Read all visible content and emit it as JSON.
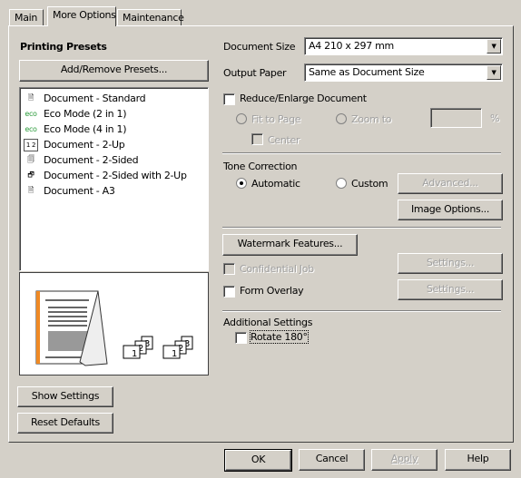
{
  "tabs": [
    {
      "label": "Main"
    },
    {
      "label": "More Options",
      "active": true
    },
    {
      "label": "Maintenance"
    }
  ],
  "presets": {
    "title": "Printing Presets",
    "add_remove_label": "Add/Remove Presets...",
    "items": [
      {
        "label": "Document - Standard",
        "icon": "document-icon"
      },
      {
        "label": "Eco Mode (2 in 1)",
        "icon": "eco-icon"
      },
      {
        "label": "Eco Mode (4 in 1)",
        "icon": "eco-icon"
      },
      {
        "label": "Document - 2-Up",
        "icon": "two-up-icon"
      },
      {
        "label": "Document - 2-Sided",
        "icon": "two-sided-icon"
      },
      {
        "label": "Document - 2-Sided with 2-Up",
        "icon": "two-sided-two-up-icon"
      },
      {
        "label": "Document - A3",
        "icon": "document-icon"
      }
    ]
  },
  "preview": {
    "accent": "#f08a24",
    "stack_labels": [
      "1",
      "2",
      "3"
    ]
  },
  "show_settings_label": "Show Settings",
  "reset_defaults_label": "Reset Defaults",
  "document_size": {
    "label": "Document Size",
    "value": "A4 210 x 297 mm"
  },
  "output_paper": {
    "label": "Output Paper",
    "value": "Same as Document Size"
  },
  "reduce_enlarge": {
    "label": "Reduce/Enlarge Document",
    "checked": false,
    "fit_to_page": "Fit to Page",
    "zoom_to": "Zoom to",
    "zoom_value": "",
    "percent": "%",
    "center": "Center"
  },
  "tone": {
    "title": "Tone Correction",
    "automatic": "Automatic",
    "custom": "Custom",
    "selected": "Automatic",
    "advanced_label": "Advanced...",
    "image_options_label": "Image Options..."
  },
  "watermark_label": "Watermark Features...",
  "confidential_job": {
    "label": "Confidential Job",
    "checked": false,
    "settings_label": "Settings..."
  },
  "form_overlay": {
    "label": "Form Overlay",
    "checked": false,
    "settings_label": "Settings..."
  },
  "additional": {
    "title": "Additional Settings",
    "rotate_label": "Rotate 180°",
    "rotate_checked": false
  },
  "footer": {
    "ok": "OK",
    "cancel": "Cancel",
    "apply": "Apply",
    "help": "Help"
  }
}
